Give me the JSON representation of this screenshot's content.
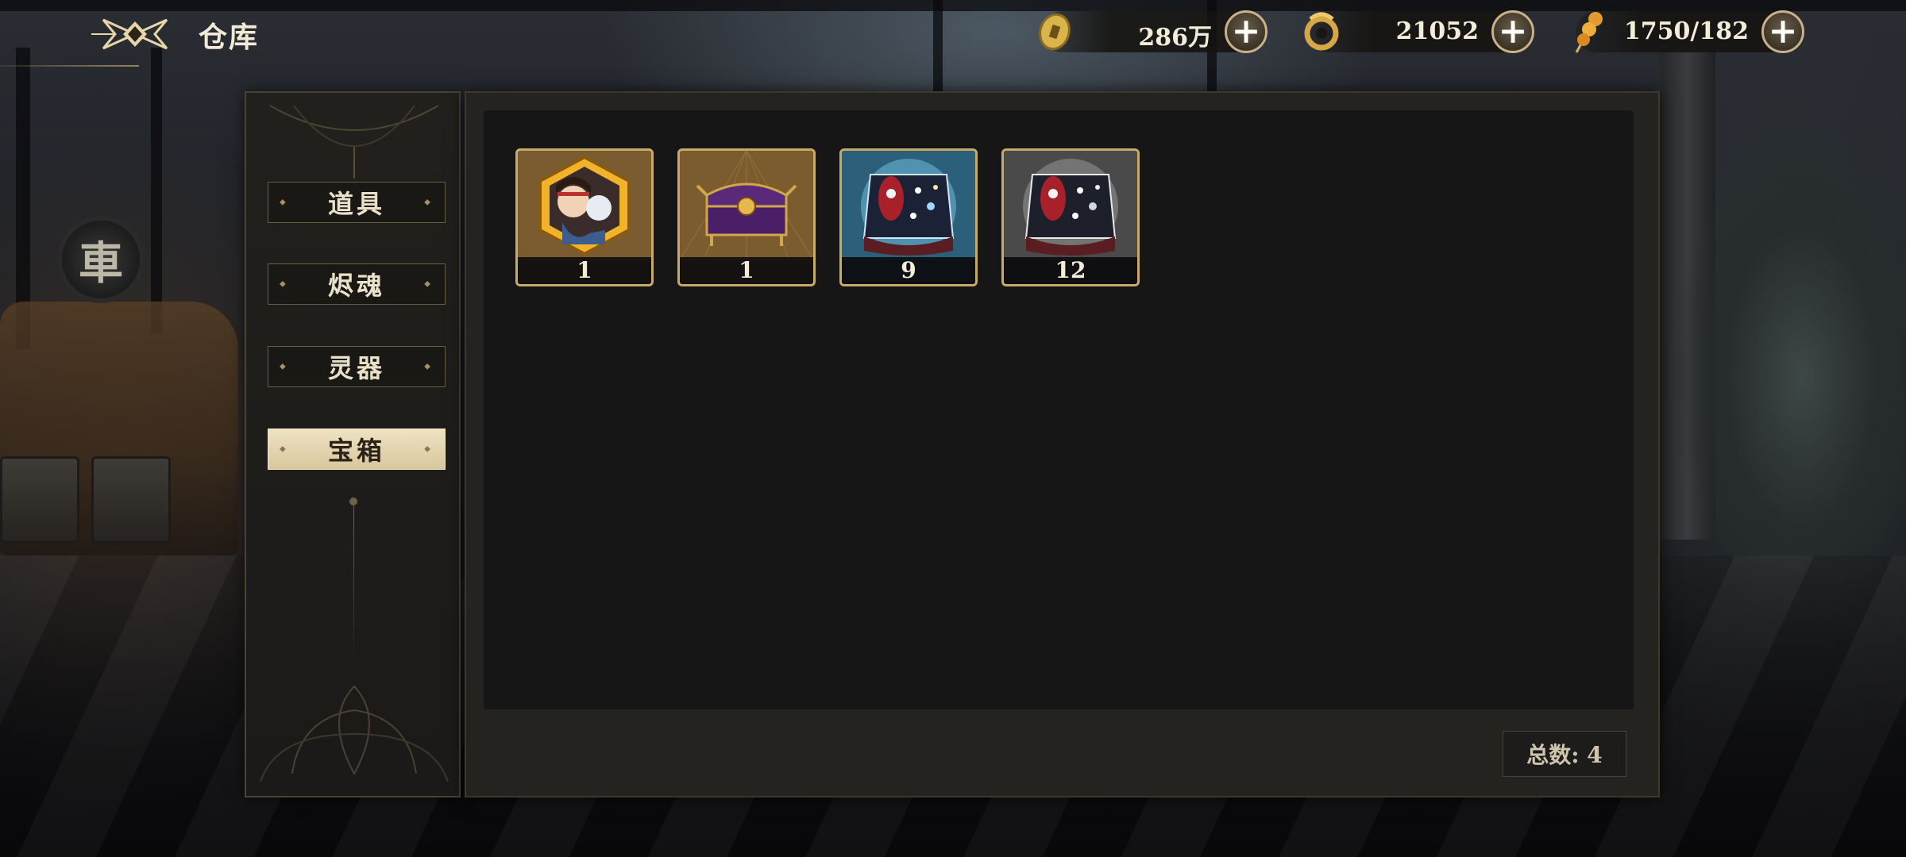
{
  "header": {
    "title": "仓库",
    "back_icon": "winged-emblem-icon"
  },
  "resources": [
    {
      "name": "coin",
      "icon": "gold-coin-icon",
      "value": "286万"
    },
    {
      "name": "jade",
      "icon": "dragon-jade-icon",
      "value": "21052"
    },
    {
      "name": "stamina",
      "icon": "candied-haws-icon",
      "value": "1750/182"
    }
  ],
  "sidebar": {
    "tabs": [
      {
        "label": "道具",
        "active": false
      },
      {
        "label": "烬魂",
        "active": false
      },
      {
        "label": "灵器",
        "active": false
      },
      {
        "label": "宝箱",
        "active": true
      }
    ]
  },
  "items": [
    {
      "icon": "character-portrait-chest-icon",
      "count": "1"
    },
    {
      "icon": "purple-treasure-chest-icon",
      "count": "1"
    },
    {
      "icon": "blue-gacha-chest-icon",
      "count": "9"
    },
    {
      "icon": "silver-gacha-chest-icon",
      "count": "12"
    }
  ],
  "footer": {
    "total": "总数: 4"
  },
  "colors": {
    "accent_gold": "#c7a968",
    "active_tab": "#efe3c2",
    "panel": "#242320",
    "grid": "#161616"
  }
}
